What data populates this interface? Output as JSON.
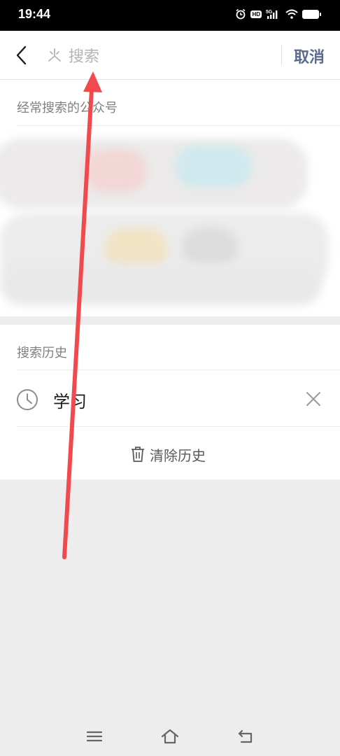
{
  "status_bar": {
    "time": "19:44",
    "network": "5G",
    "hd": "HD"
  },
  "header": {
    "back_icon": "back-arrow-icon",
    "search_placeholder": "搜索",
    "cancel_label": "取消"
  },
  "frequent": {
    "title": "经常搜索的公众号",
    "obscured": true
  },
  "history": {
    "title": "搜索历史",
    "items": [
      {
        "text": "学习",
        "icon": "clock-icon"
      }
    ],
    "clear_label": "清除历史"
  },
  "nav": {
    "menu_icon": "menu-icon",
    "home_icon": "home-icon",
    "back_icon": "back-icon"
  },
  "colors": {
    "accent_link": "#5a6b8c",
    "annotation_arrow": "#f04a4f",
    "page_bg": "#ededed"
  }
}
